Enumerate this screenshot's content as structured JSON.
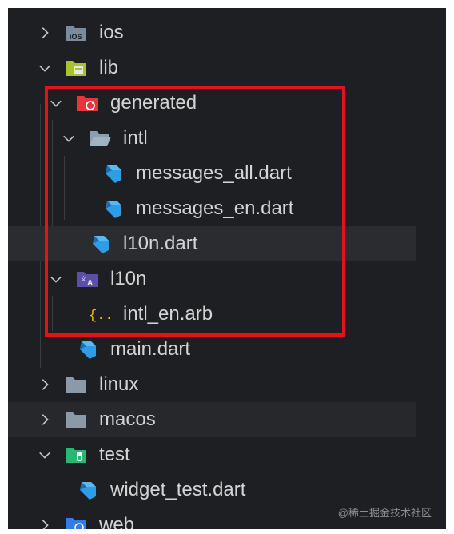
{
  "tree": {
    "items": [
      {
        "label": "ios",
        "icon": "ios-folder-icon",
        "expanded": false
      },
      {
        "label": "lib",
        "icon": "lib-folder-icon",
        "expanded": true
      },
      {
        "label": "generated",
        "icon": "generated-folder-icon",
        "expanded": true
      },
      {
        "label": "intl",
        "icon": "folder-open-icon",
        "expanded": true
      },
      {
        "label": "messages_all.dart",
        "icon": "dart-file-icon"
      },
      {
        "label": "messages_en.dart",
        "icon": "dart-file-icon"
      },
      {
        "label": "l10n.dart",
        "icon": "dart-file-icon"
      },
      {
        "label": "l10n",
        "icon": "l10n-folder-icon",
        "expanded": true
      },
      {
        "label": "intl_en.arb",
        "icon": "arb-file-icon"
      },
      {
        "label": "main.dart",
        "icon": "dart-file-icon"
      },
      {
        "label": "linux",
        "icon": "folder-icon",
        "expanded": false
      },
      {
        "label": "macos",
        "icon": "folder-icon",
        "expanded": false
      },
      {
        "label": "test",
        "icon": "test-folder-icon",
        "expanded": true
      },
      {
        "label": "widget_test.dart",
        "icon": "dart-file-icon"
      },
      {
        "label": "web",
        "icon": "web-folder-icon",
        "expanded": false
      }
    ]
  },
  "watermark": "@稀土掘金技术社区",
  "colors": {
    "background": "#1e1f22",
    "text": "#d4d4d4",
    "highlight_box": "#e0141b",
    "dart_blue": "#2f9ce6"
  }
}
